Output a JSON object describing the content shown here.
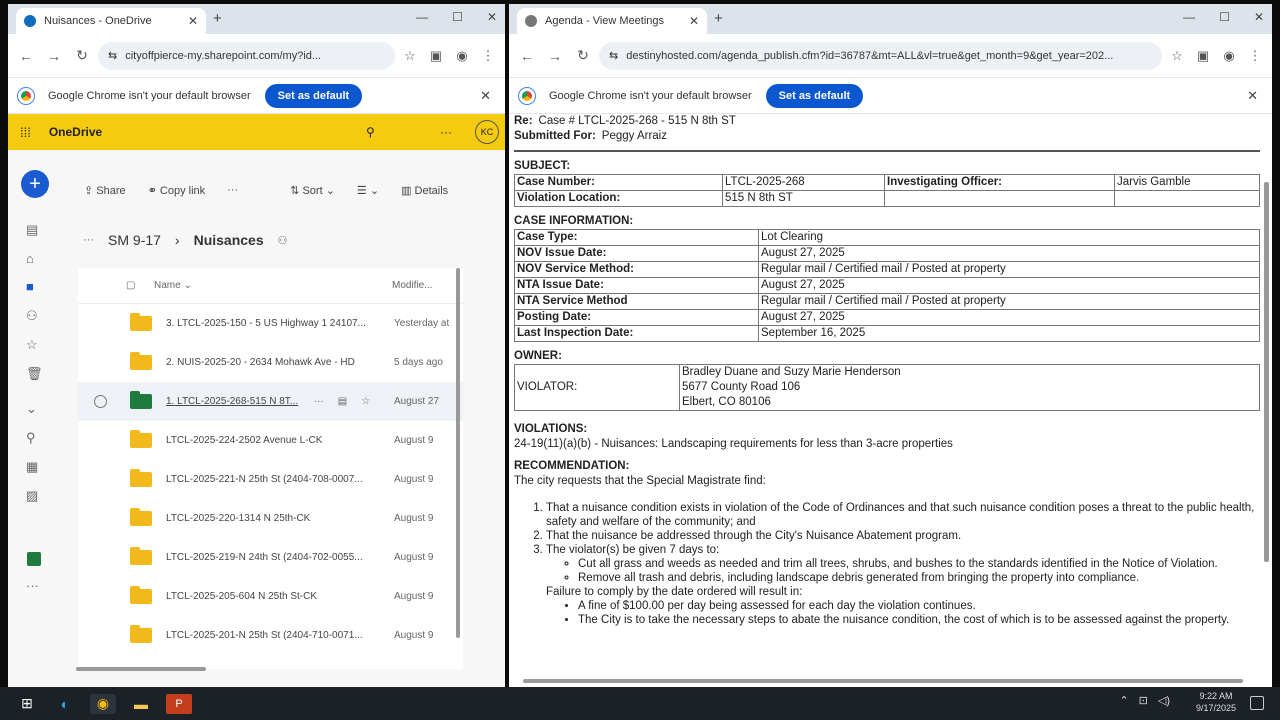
{
  "left_window": {
    "tab_title": "Nuisances - OneDrive",
    "url": "cityoffpierce-my.sharepoint.com/my?id...",
    "default_bar_text": "Google Chrome isn't your default browser",
    "default_btn": "Set as default",
    "app_name": "OneDrive",
    "avatar": "KC",
    "toolbar": {
      "share": "Share",
      "copy_link": "Copy link",
      "more": "···",
      "sort": "Sort",
      "details": "Details"
    },
    "breadcrumb": {
      "more": "···",
      "parent": "SM 9-17",
      "current": "Nuisances"
    },
    "columns": {
      "name": "Name",
      "modified": "Modifie..."
    },
    "rows": [
      {
        "name": "3. LTCL-2025-150 - 5 US Highway 1 24107...",
        "date": "Yesterday at"
      },
      {
        "name": "2. NUIS-2025-20 - 2634 Mohawk Ave - HD",
        "date": "5 days ago"
      },
      {
        "name": "1. LTCL-2025-268-515 N 8T...",
        "date": "August 27"
      },
      {
        "name": "LTCL-2025-224-2502 Avenue L-CK",
        "date": "August 9"
      },
      {
        "name": "LTCL-2025-221-N 25th St (2404-708-0007...",
        "date": "August 9"
      },
      {
        "name": "LTCL-2025-220-1314 N 25th-CK",
        "date": "August 9"
      },
      {
        "name": "LTCL-2025-219-N 24th St (2404-702-0055...",
        "date": "August 9"
      },
      {
        "name": "LTCL-2025-205-604 N 25th St-CK",
        "date": "August 9"
      },
      {
        "name": "LTCL-2025-201-N 25th St (2404-710-0071...",
        "date": "August 9"
      }
    ]
  },
  "right_window": {
    "tab_title": "Agenda - View Meetings",
    "url": "destinyhosted.com/agenda_publish.cfm?id=36787&mt=ALL&vl=true&get_month=9&get_year=202...",
    "default_bar_text": "Google Chrome isn't your default browser",
    "default_btn": "Set as default",
    "re_label": "Re:",
    "re_value": "Case # LTCL-2025-268 - 515 N 8th ST",
    "submitted_label": "Submitted For:",
    "submitted_value": "Peggy Arraiz",
    "subject": "SUBJECT:",
    "case_number_label": "Case Number:",
    "case_number": "LTCL-2025-268",
    "officer_label": "Investigating Officer:",
    "officer": "Jarvis Gamble",
    "location_label": "Violation Location:",
    "location": "515 N 8th ST",
    "case_info": "CASE INFORMATION:",
    "info_rows": [
      {
        "k": "Case Type:",
        "v": "Lot Clearing"
      },
      {
        "k": "NOV Issue Date:",
        "v": "August 27, 2025"
      },
      {
        "k": "NOV Service Method:",
        "v": "Regular mail / Certified mail / Posted at property"
      },
      {
        "k": "NTA Issue Date:",
        "v": "August 27, 2025"
      },
      {
        "k": "NTA Service Method",
        "v": "Regular mail / Certified mail / Posted at property"
      },
      {
        "k": "Posting Date:",
        "v": "August 27, 2025"
      },
      {
        "k": "Last Inspection Date:",
        "v": "September 16, 2025"
      }
    ],
    "owner": "OWNER:",
    "violator_label": "VIOLATOR:",
    "violator_name": "Bradley Duane and Suzy Marie Henderson",
    "violator_addr1": "5677 County Road 106",
    "violator_addr2": "Elbert, CO 80106",
    "violations": "VIOLATIONS:",
    "violation_text": "24-19(11)(a)(b) - Nuisances: Landscaping requirements for less than 3-acre properties",
    "recommendation": "RECOMMENDATION:",
    "rec_intro": "The city requests that the Special Magistrate find:",
    "rec1": "That a nuisance condition exists in violation of the Code of Ordinances and that such nuisance condition poses a threat to the public health, safety and welfare of the community; and",
    "rec2": "That the nuisance be addressed through the City's Nuisance Abatement program.",
    "rec3": "The violator(s) be given 7 days to:",
    "sub1": "Cut all grass and weeds as needed and trim all trees, shrubs, and bushes to the standards identified in the Notice of Violation.",
    "sub2": "Remove all trash and debris, including landscape debris generated from bringing the property into compliance.",
    "failure": "Failure to comply by the date ordered will result in:",
    "fail1": "A fine of $100.00 per day being assessed for each day the violation continues.",
    "fail2": "The City is to take the necessary steps to abate the nuisance condition, the cost of which is to be assessed against the property."
  },
  "taskbar": {
    "time": "9:22 AM",
    "date": "9/17/2025"
  }
}
